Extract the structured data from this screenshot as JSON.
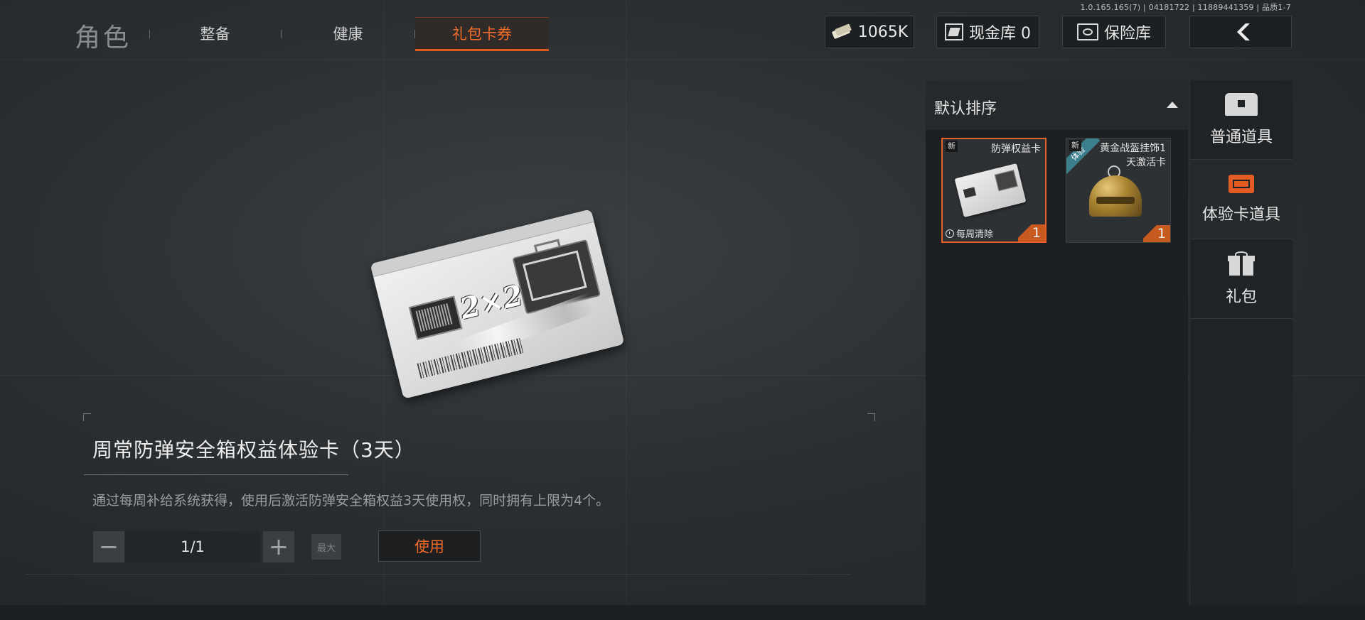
{
  "version": "1.0.165.165(7) | 04181722 | 11889441359 | 品质1-7",
  "nav": {
    "title": "角色",
    "tabs": [
      {
        "label": "整备"
      },
      {
        "label": "健康"
      },
      {
        "label": "礼包卡券"
      }
    ],
    "active_tab": "礼包卡券"
  },
  "header": {
    "currency": "1065K",
    "cash_vault": "现金库 0",
    "safe": "保险库",
    "back_icon": "chevron-left-icon"
  },
  "item": {
    "name": "周常防弹安全箱权益体验卡（3天）",
    "description": "通过每周补给系统获得，使用后激活防弹安全箱权益3天使用权，同时拥有上限为4个。",
    "card_art_text": "2×2",
    "quantity": "1/1",
    "max_label": "最大",
    "use_label": "使用"
  },
  "inventory": {
    "sort_label": "默认排序",
    "slots": [
      {
        "name": "防弹权益卡",
        "new": "新",
        "count": "1",
        "tag": "每周清除",
        "selected": true
      },
      {
        "name": "黄金战盔挂饰1天激活卡",
        "new": "新",
        "count": "1",
        "badge": "体验",
        "selected": false
      }
    ]
  },
  "categories": [
    {
      "label": "普通道具",
      "icon": "chest-icon"
    },
    {
      "label": "体验卡道具",
      "icon": "card-icon",
      "active": true
    },
    {
      "label": "礼包",
      "icon": "gift-icon"
    }
  ],
  "colors": {
    "accent": "#e65f24",
    "background": "#2b2f32",
    "panel": "#1d2022"
  }
}
